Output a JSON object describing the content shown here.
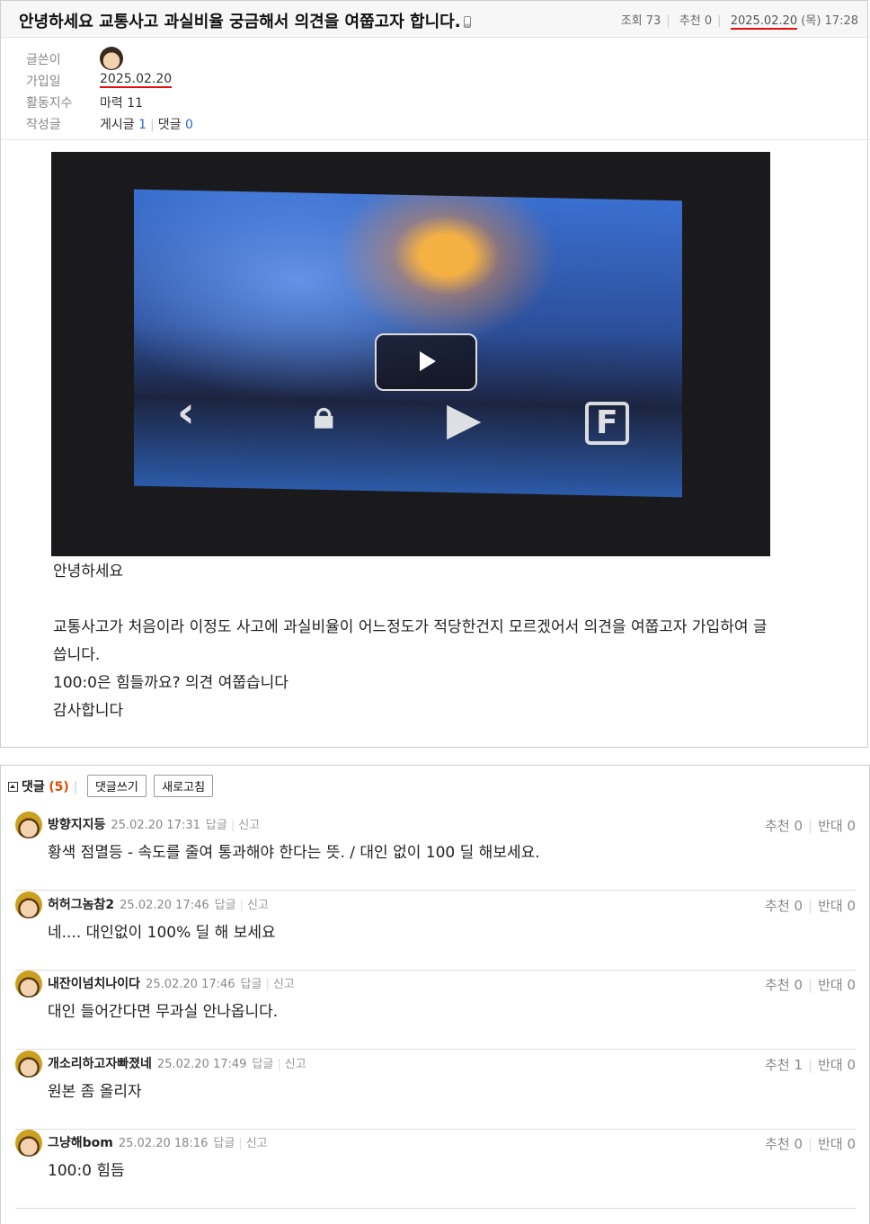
{
  "post": {
    "title": "안녕하세요 교통사고 과실비율 궁금해서 의견을 여쭙고자 합니다.",
    "views_label": "조회",
    "views": "73",
    "recommend_label": "추천",
    "recommend": "0",
    "date": "2025.02.20",
    "weekday": "(목)",
    "time": "17:28"
  },
  "author": {
    "writer_label": "글쓴이",
    "joined_label": "가입일",
    "joined": "2025.02.20",
    "activity_label": "활동지수",
    "activity": "마력 11",
    "posts_label": "작성글",
    "posts_text": "게시글",
    "posts_count": "1",
    "comments_text": "댓글",
    "comments_count": "0"
  },
  "video": {
    "controls": [
      "back",
      "lock",
      "play-circle",
      "F-camera"
    ]
  },
  "body": {
    "line1": "안녕하세요",
    "line2": "교통사고가 처음이라 이정도 사고에 과실비율이 어느정도가 적당한건지 모르겠어서 의견을 여쭙고자 가입하여 글",
    "line3": "씁니다.",
    "line4": " 100:0은 힘들까요? 의견 여쭙습니다",
    "line5": "감사합니다"
  },
  "comments_section": {
    "label": "댓글",
    "count": "(5)",
    "write_button": "댓글쓰기",
    "refresh_button": "새로고침",
    "reply_label": "답글",
    "report_label": "신고",
    "recommend_label": "추천",
    "oppose_label": "반대",
    "items": [
      {
        "name": "방향지지등",
        "date": "25.02.20 17:31",
        "up": "0",
        "down": "0",
        "text": "황색 점멸등 - 속도를 줄여 통과해야 한다는 뜻. / 대인 없이 100 딜 해보세요."
      },
      {
        "name": "허허그놈참2",
        "date": "25.02.20 17:46",
        "up": "0",
        "down": "0",
        "text": "네.... 대인없이 100% 딜 해 보세요"
      },
      {
        "name": "내잔이넘치나이다",
        "date": "25.02.20 17:46",
        "up": "0",
        "down": "0",
        "text": "대인 들어간다면 무과실 안나옵니다."
      },
      {
        "name": "개소리하고자빠졌네",
        "date": "25.02.20 17:49",
        "up": "1",
        "down": "0",
        "text": "원본 좀 올리자"
      },
      {
        "name": "그냥해bom",
        "date": "25.02.20 18:16",
        "up": "0",
        "down": "0",
        "text": "100:0 힘듬"
      }
    ]
  }
}
